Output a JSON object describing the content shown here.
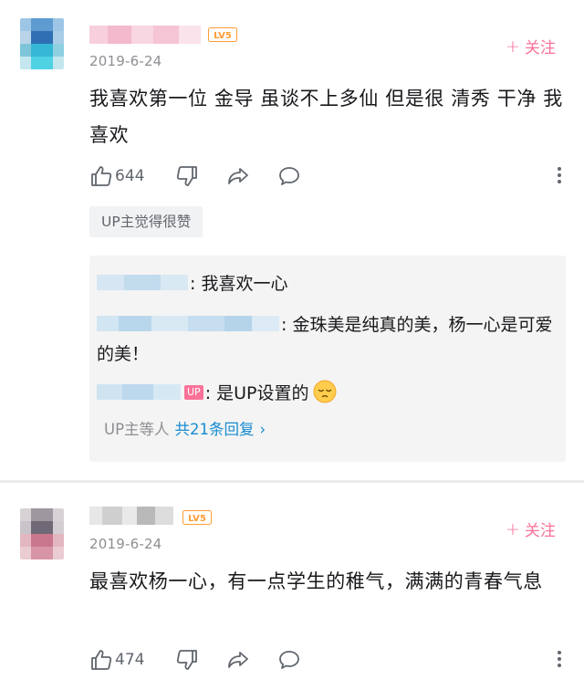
{
  "comments": [
    {
      "level": "LV5",
      "date": "2019-6-24",
      "follow_label": "关注",
      "content": "我喜欢第一位 金导  虽谈不上多仙 但是很 清秀 干净 我喜欢",
      "like_count": "644",
      "up_tag": "UP主觉得很赞",
      "replies": [
        {
          "text": "我喜欢一心"
        },
        {
          "text": "金珠美是纯真的美，杨一心是可爱的美！"
        },
        {
          "badge": "UP",
          "text": "是UP设置的",
          "emoji": "pensive-face"
        }
      ],
      "reply_summary": {
        "prefix": "UP主等人",
        "link": "共21条回复",
        "arrow": "›"
      }
    },
    {
      "level": "LV5",
      "date": "2019-6-24",
      "follow_label": "关注",
      "content": "最喜欢杨一心，有一点学生的稚气，满满的青春气息",
      "like_count": "474"
    }
  ],
  "colors": {
    "accent_pink": "#fb7299",
    "link_blue": "#178bcf",
    "level_orange": "#ff9c33",
    "icon_gray": "#61666d"
  },
  "icons": [
    "thumbs-up-icon",
    "thumbs-down-icon",
    "share-icon",
    "comment-icon",
    "more-vertical-icon",
    "plus-icon",
    "chevron-right-icon"
  ]
}
